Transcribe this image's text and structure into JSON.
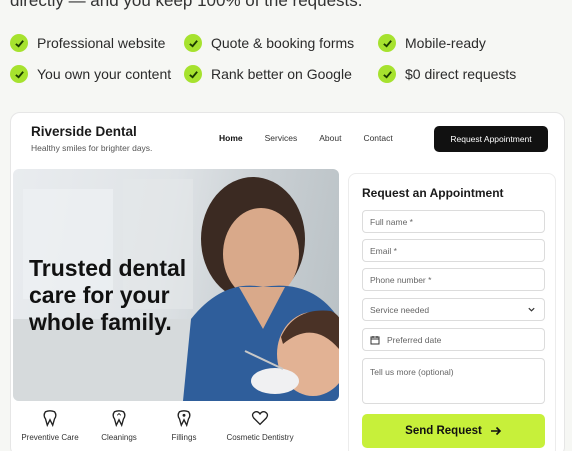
{
  "headline": "directly — and you keep 100% of the requests.",
  "features": [
    {
      "label": "Professional website"
    },
    {
      "label": "Quote & booking forms"
    },
    {
      "label": "Mobile-ready"
    },
    {
      "label": "You own your content"
    },
    {
      "label": "Rank better on Google"
    },
    {
      "label": "$0 direct requests"
    }
  ],
  "site": {
    "brand": "Riverside Dental",
    "tagline": "Healthy smiles for brighter days.",
    "nav": [
      "Home",
      "Services",
      "About",
      "Contact"
    ],
    "cta": "Request Appointment",
    "hero_heading": "Trusted dental care for your whole family.",
    "services": [
      "Preventive Care",
      "Cleanings",
      "Fillings",
      "Cosmetic Dentistry"
    ],
    "form": {
      "title": "Request an Appointment",
      "full_name": "Full name *",
      "email": "Email *",
      "phone": "Phone number *",
      "service": "Service needed",
      "date": "Preferred date",
      "message": "Tell us more (optional)",
      "submit": "Send Request"
    }
  },
  "colors": {
    "accent": "#c7f03a",
    "check": "#a6e22e",
    "dark": "#111111"
  }
}
